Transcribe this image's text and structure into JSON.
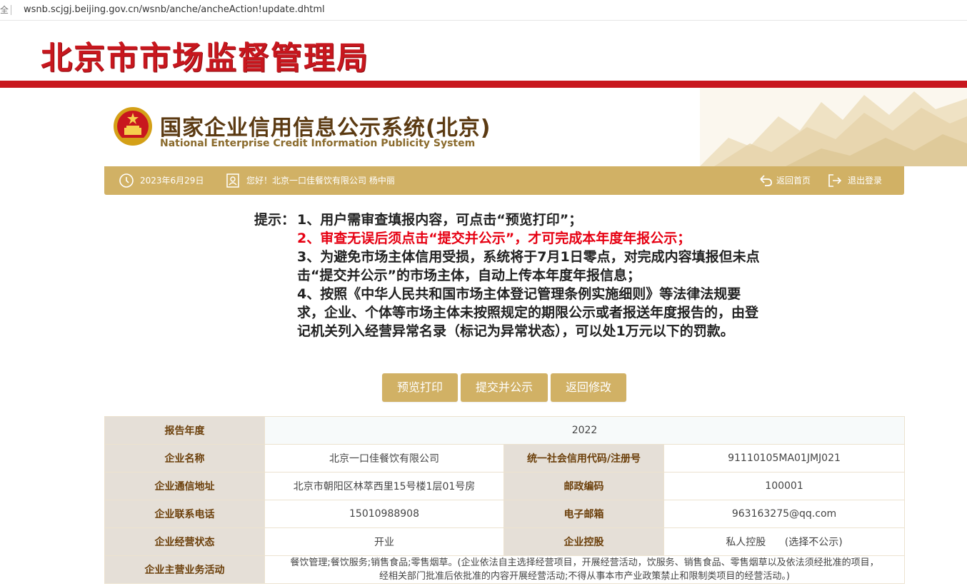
{
  "browser": {
    "url": "wsnb.scjgj.beijing.gov.cn/wsnb/anche/ancheAction!update.dhtml",
    "lock_glyph": "全"
  },
  "agency": {
    "title": "北京市市场监督管理局"
  },
  "system": {
    "title_cn": "国家企业信用信息公示系统(北京)",
    "title_en": "National Enterprise Credit Information Publicity System"
  },
  "toolbar": {
    "date": "2023年6月29日",
    "greeting": "您好！北京一口佳餐饮有限公司  杨中丽",
    "home_label": "返回首页",
    "logout_label": "退出登录"
  },
  "notice": {
    "prefix": "提示：",
    "item1": "1、用户需审查填报内容，可点击“预览打印”；",
    "item2": "2、审查无误后须点击“提交并公示”，才可完成本年度年报公示；",
    "item3": "3、为避免市场主体信用受损，系统将于7月1日零点，对完成内容填报但未点击“提交并公示”的市场主体，自动上传本年度年报信息；",
    "item4": "4、按照《中华人民共和国市场主体登记管理条例实施细则》等法律法规要求，企业、个体等市场主体未按照规定的期限公示或者报送年度报告的，由登记机关列入经营异常名录（标记为异常状态），可以处1万元以下的罚款。"
  },
  "buttons": {
    "preview": "预览打印",
    "submit": "提交并公示",
    "back": "返回修改"
  },
  "table": {
    "year_label": "报告年度",
    "year_value": "2022",
    "name_label": "企业名称",
    "name_value": "北京一口佳餐饮有限公司",
    "credit_label": "统一社会信用代码/注册号",
    "credit_value": "91110105MA01JMJ021",
    "address_label": "企业通信地址",
    "address_value": "北京市朝阳区林萃西里15号楼1层01号房",
    "postcode_label": "邮政编码",
    "postcode_value": "100001",
    "phone_label": "企业联系电话",
    "phone_value": "15010988908",
    "email_label": "电子邮箱",
    "email_value": "963163275@qq.com",
    "status_label": "企业经营状态",
    "status_value": "开业",
    "holding_label": "企业控股",
    "holding_value": "私人控股",
    "holding_note": "(选择不公示)",
    "business_label": "企业主营业务活动",
    "business_line1": "餐饮管理;餐饮服务;销售食品;零售烟草。(企业依法自主选择经营项目，开展经营活动，饮服务、销售食品、零售烟草以及依法须经批准的项目，",
    "business_line2": "经相关部门批准后依批准的内容开展经营活动;不得从事本市产业政策禁止和限制类项目的经营活动。)"
  },
  "colors": {
    "accent_red": "#c8171e",
    "gold": "#d1b165",
    "notice_red": "#e60012"
  }
}
